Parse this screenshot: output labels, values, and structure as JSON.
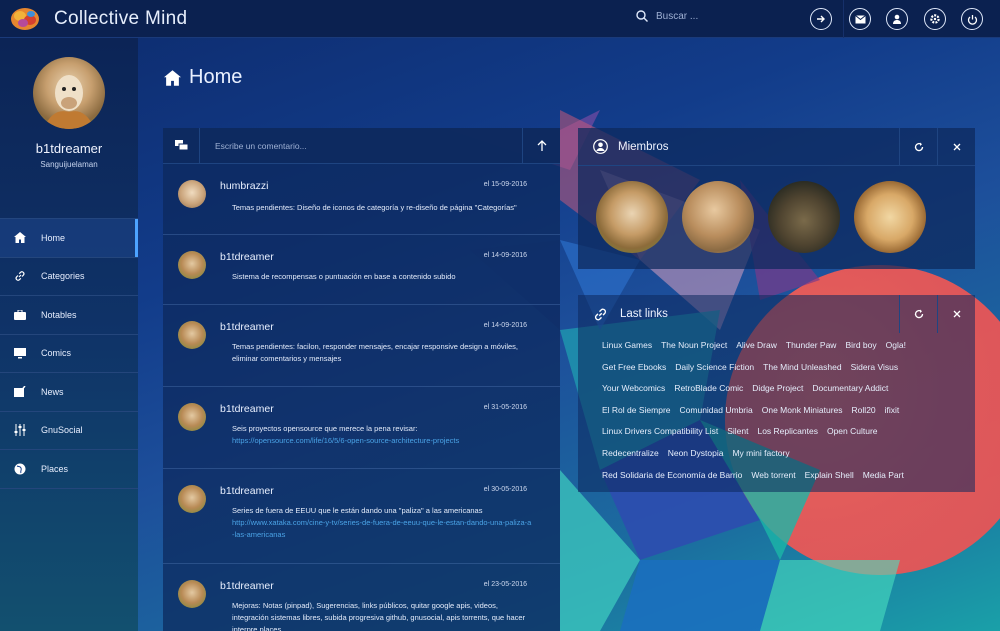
{
  "app": {
    "title": "Collective Mind"
  },
  "search": {
    "placeholder": "Buscar ..."
  },
  "topbar_icons": [
    "arrow-right-circle-icon",
    "message-icon",
    "user-icon",
    "gear-icon",
    "power-icon"
  ],
  "user": {
    "name": "b1tdreamer",
    "subtitle": "Sanguijuelaman"
  },
  "sidebar": {
    "items": [
      {
        "label": "Home",
        "icon": "home-icon",
        "active": true
      },
      {
        "label": "Categories",
        "icon": "link-icon",
        "active": false
      },
      {
        "label": "Notables",
        "icon": "briefcase-icon",
        "active": false
      },
      {
        "label": "Comics",
        "icon": "monitor-icon",
        "active": false
      },
      {
        "label": "News",
        "icon": "news-icon",
        "active": false
      },
      {
        "label": "GnuSocial",
        "icon": "sliders-icon",
        "active": false
      },
      {
        "label": "Places",
        "icon": "globe-icon",
        "active": false
      }
    ]
  },
  "page": {
    "title": "Home"
  },
  "comment_box": {
    "placeholder": "Escribe un comentario..."
  },
  "posts": [
    {
      "author": "humbrazzi",
      "date": "el 15-09-2016",
      "text": "Temas pendientes: Diseño de iconos de categoría y re-diseño de página \"Categorías\"",
      "link": ""
    },
    {
      "author": "b1tdreamer",
      "date": "el 14-09-2016",
      "text": "Sistema de recompensas o puntuación en base a contenido subido",
      "link": ""
    },
    {
      "author": "b1tdreamer",
      "date": "el 14-09-2016",
      "text": "Temas pendientes: facilon, responder mensajes, encajar responsive design a móviles, eliminar comentarios y mensajes",
      "link": ""
    },
    {
      "author": "b1tdreamer",
      "date": "el 31-05-2016",
      "text": "Seis proyectos opensource que merece la pena revisar:",
      "link": "https://opensource.com/life/16/5/6-open-source-architecture-projects"
    },
    {
      "author": "b1tdreamer",
      "date": "el 30-05-2016",
      "text": "Series de fuera de EEUU que le están dando una \"paliza\" a las americanas",
      "link": "http://www.xataka.com/cine-y-tv/series-de-fuera-de-eeuu-que-le-estan-dando-una-paliza-a-las-americanas"
    },
    {
      "author": "b1tdreamer",
      "date": "el 23-05-2016",
      "text": "Mejoras: Notas (pinpad), Sugerencias, links públicos, quitar google apis, videos, integración sistemas libres, subida progresiva github, gnusocial, apis torrents, que hacer interpre places",
      "link": ""
    }
  ],
  "members": {
    "title": "Miembros",
    "count_shown": 4
  },
  "links": {
    "title": "Last links",
    "items": [
      "Linux Games",
      "The Noun Project",
      "Alive Draw",
      "Thunder Paw",
      "Bird boy",
      "Ogla!",
      "Get Free Ebooks",
      "Daily Science Fiction",
      "The Mind Unleashed",
      "Sidera Visus",
      "Your Webcomics",
      "RetroBlade Comic",
      "Didge Project",
      "Documentary Addict",
      "El Rol de Siempre",
      "Comunidad Umbria",
      "One Monk Miniatures",
      "Roll20",
      "ifixit",
      "Linux Drivers Compatibility List",
      "Silent",
      "Los Replicantes",
      "Open Culture",
      "Redecentralize",
      "Neon Dystopia",
      "My mini factory",
      "Red Solidaria de Economía de Barrio",
      "Web torrent",
      "Explain Shell",
      "Media Part"
    ]
  },
  "colors": {
    "topbar": "#0b2150",
    "accent": "#4da3ff",
    "link": "#4aa3e6",
    "coral": "#f0584f"
  }
}
